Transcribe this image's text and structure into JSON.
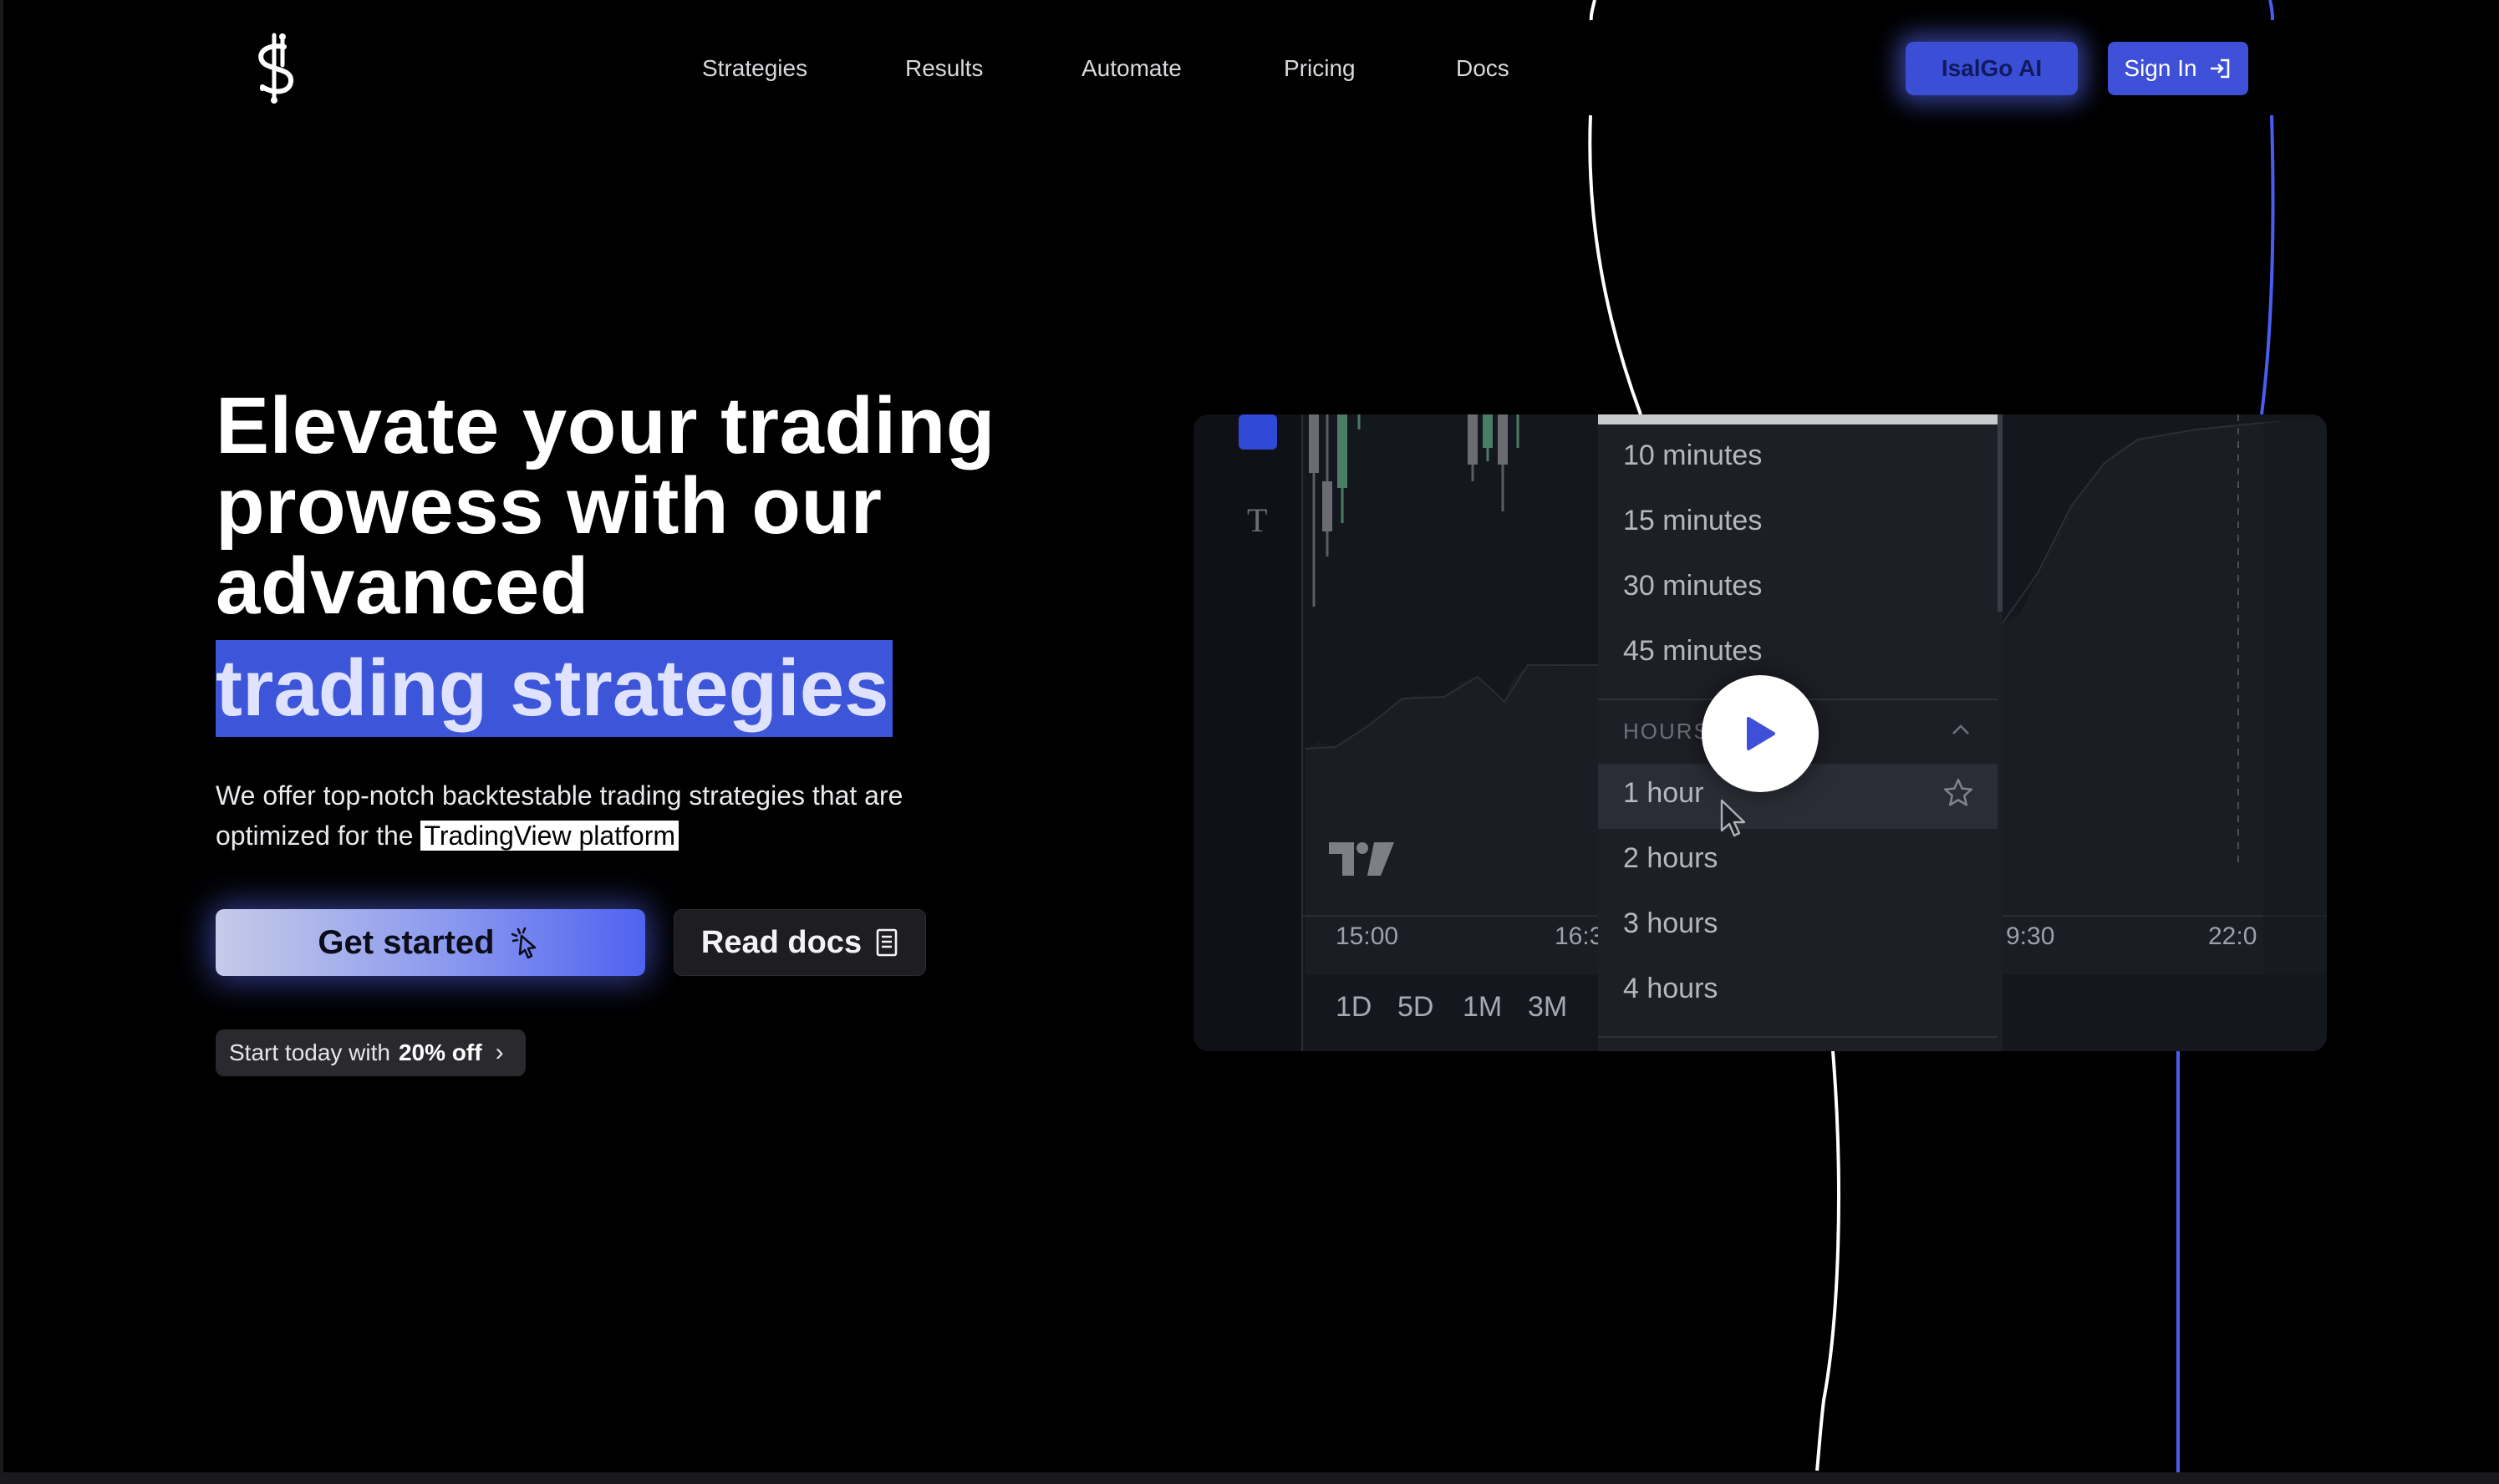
{
  "nav": {
    "links": [
      "Strategies",
      "Results",
      "Automate",
      "Pricing",
      "Docs"
    ],
    "ai_button": "IsalGo AI",
    "signin_button": "Sign In"
  },
  "hero": {
    "title_lines": [
      "Elevate your trading",
      "prowess with our",
      "advanced"
    ],
    "highlight": "trading strategies",
    "lead_prefix": "We offer top-notch backtestable trading strategies that are optimized for the",
    "lead_link": "TradingView platform",
    "cta_primary": "Get started",
    "cta_secondary": "Read docs",
    "promo_prefix": "Start today with",
    "promo_bold": "20% off",
    "promo_chevron": "›"
  },
  "video": {
    "timeframes": [
      "10 minutes",
      "15 minutes",
      "30 minutes",
      "45 minutes"
    ],
    "section_label": "HOURS",
    "hours": [
      "1 hour",
      "2 hours",
      "3 hours",
      "4 hours"
    ],
    "x_axis": [
      "15:00",
      "16:3",
      "9:30",
      "22:0"
    ],
    "ranges": [
      "1D",
      "5D",
      "1M",
      "3M"
    ],
    "play_icon": "play-icon"
  },
  "colors": {
    "accent": "#3f50d8",
    "highlight_bg": "#3c55d9",
    "background": "#000000"
  }
}
